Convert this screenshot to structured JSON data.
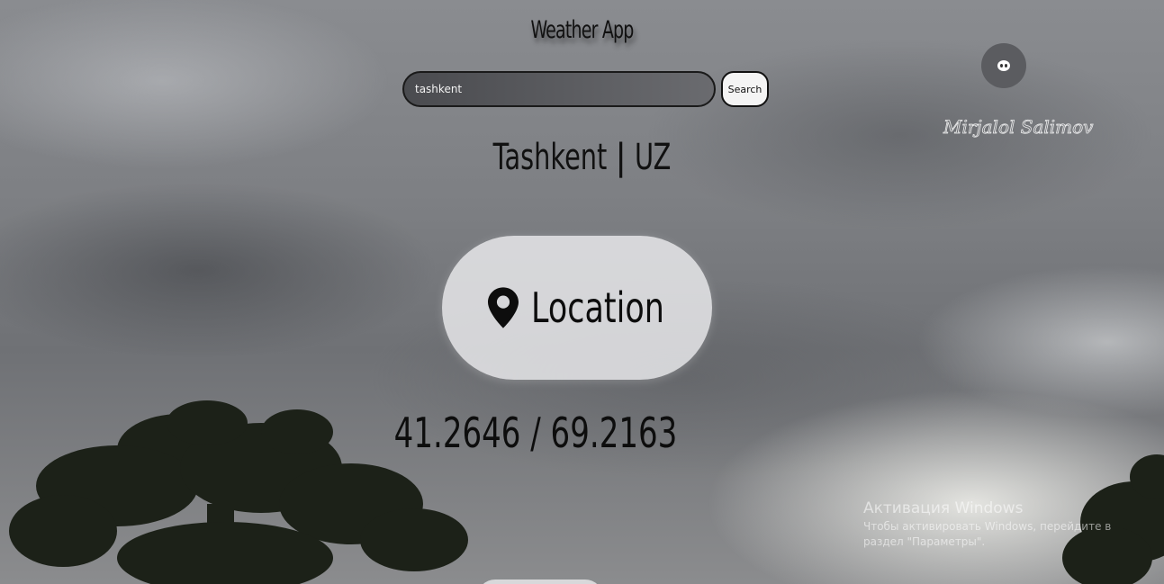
{
  "header": {
    "title": "Weather App"
  },
  "search": {
    "value": "tashkent",
    "button_label": "Search"
  },
  "place": {
    "city": "Tashkent",
    "separator": "|",
    "country": "UZ"
  },
  "location_button": {
    "label": "Location",
    "icon": "map-pin-icon"
  },
  "coordinates": {
    "text": "41.2646 / 69.2163"
  },
  "profile": {
    "avatar_icon": "avatar-icon",
    "signature": "Mirjalol Salimov"
  },
  "os_watermark": {
    "title": "Активация Windows",
    "line1": "Чтобы активировать Windows, перейдите в",
    "line2": "раздел \"Параметры\"."
  }
}
